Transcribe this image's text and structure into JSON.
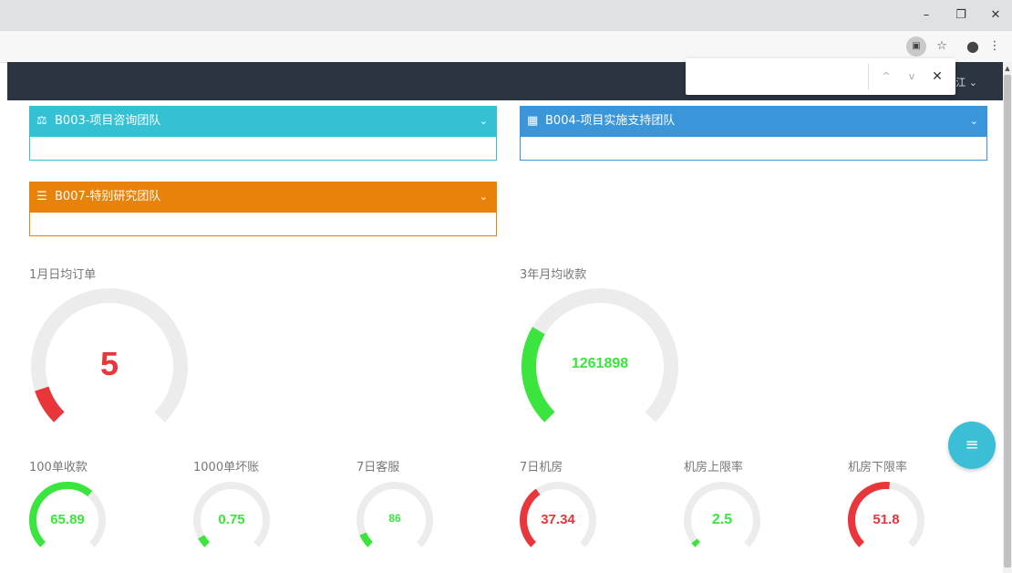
{
  "window": {
    "minimize": "–",
    "restore": "❐",
    "close": "✕"
  },
  "toolbar": {
    "ext_icon": "▣",
    "star_icon": "☆",
    "profile_icon": "●",
    "menu_icon": "⋮"
  },
  "findbar": {
    "value": "",
    "up": "^",
    "down": "v",
    "close": "✕"
  },
  "header": {
    "user_suffix": "江 ⌄"
  },
  "teams": [
    {
      "id": "team-b003",
      "icon": "⚖",
      "label": "B003-项目咨询团队",
      "color": "#33c1d3",
      "chevron": "⌄"
    },
    {
      "id": "team-b004",
      "icon": "▦",
      "label": "B004-项目实施支持团队",
      "color": "#3a95d9",
      "chevron": "⌄"
    },
    {
      "id": "team-b007",
      "icon": "☰",
      "label": "B007-特别研究团队",
      "color": "#e8820a",
      "chevron": "⌄"
    }
  ],
  "big_gauges": [
    {
      "label": "1月日均订单",
      "value": "5",
      "fraction": 0.1,
      "color": "#e8363a"
    },
    {
      "label": "3年月均收款",
      "value": "1261898",
      "fraction": 0.28,
      "color": "#3be53d"
    }
  ],
  "small_gauges": [
    {
      "label": "100单收款",
      "value": "65.89",
      "fraction": 0.65,
      "color": "#3be53d"
    },
    {
      "label": "1000单坏账",
      "value": "0.75",
      "fraction": 0.06,
      "color": "#3be53d"
    },
    {
      "label": "7日客服",
      "value": "86",
      "fraction": 0.08,
      "color": "#3be53d"
    },
    {
      "label": "7日机房",
      "value": "37.34",
      "fraction": 0.37,
      "color": "#e8363a"
    },
    {
      "label": "机房上限率",
      "value": "2.5",
      "fraction": 0.03,
      "color": "#3be53d"
    },
    {
      "label": "机房下限率",
      "value": "51.8",
      "fraction": 0.52,
      "color": "#e8363a"
    }
  ],
  "fab": {
    "icon": "≡"
  },
  "track_color": "#ececec"
}
